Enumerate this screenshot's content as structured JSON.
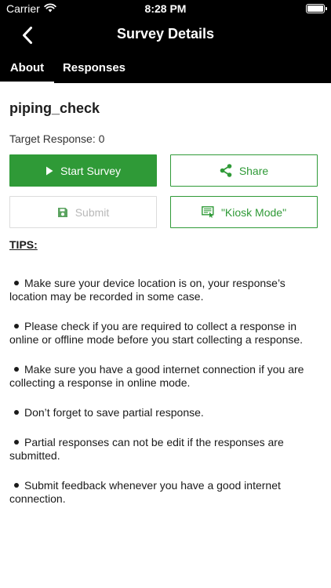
{
  "status_bar": {
    "carrier": "Carrier",
    "time": "8:28 PM"
  },
  "nav": {
    "title": "Survey Details",
    "back_icon": "chevron-left-icon"
  },
  "tabs": [
    {
      "label": "About",
      "selected": true
    },
    {
      "label": "Responses",
      "selected": false
    }
  ],
  "survey": {
    "name": "piping_check",
    "target_response": "Target Response: 0"
  },
  "actions": {
    "start_survey": "Start Survey",
    "share": "Share",
    "submit": "Submit",
    "kiosk_mode": "\"Kiosk Mode\""
  },
  "tips": {
    "heading": "TIPS:",
    "items": [
      "Make sure your device location  is on, your response’s location may be recorded in some case.",
      "Please check if you are required to collect a response in online  or offline mode before you start collecting a response.",
      "Make sure you have a good internet connection if you are collecting a response in online mode.",
      "Don’t forget to save partial response.",
      "Partial responses can not be edit if the responses are submitted.",
      "Submit feedback whenever you have a good internet connection."
    ]
  },
  "colors": {
    "header": "#000000",
    "accent": "#2f9a37",
    "disabled": "#b8b8b8"
  }
}
